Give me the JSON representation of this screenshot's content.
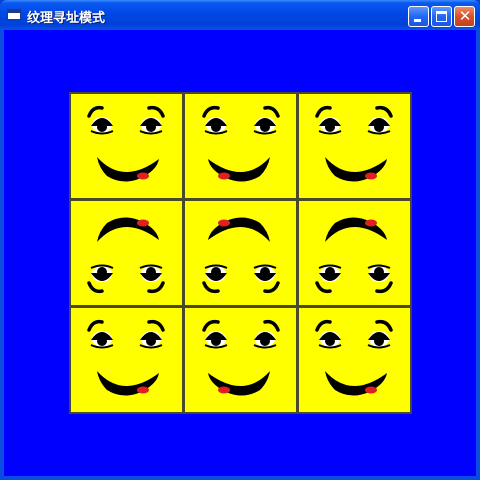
{
  "window": {
    "title": "纹理寻址模式",
    "buttons": {
      "minimize": "minimize",
      "maximize": "maximize",
      "close": "✕"
    }
  },
  "colors": {
    "client_background": "#0000FF",
    "tile_face": "#FFFF00",
    "tile_border": "#4a4a2a",
    "tongue": "#E02020"
  },
  "texture_grid": {
    "rows": 3,
    "cols": 3,
    "tiles": [
      {
        "orientation": "normal",
        "flip_x": false
      },
      {
        "orientation": "normal",
        "flip_x": true
      },
      {
        "orientation": "normal",
        "flip_x": false
      },
      {
        "orientation": "flipped",
        "flip_x": false
      },
      {
        "orientation": "flipped",
        "flip_x": true
      },
      {
        "orientation": "flipped",
        "flip_x": false
      },
      {
        "orientation": "normal",
        "flip_x": false
      },
      {
        "orientation": "normal",
        "flip_x": true
      },
      {
        "orientation": "normal",
        "flip_x": false
      }
    ]
  }
}
